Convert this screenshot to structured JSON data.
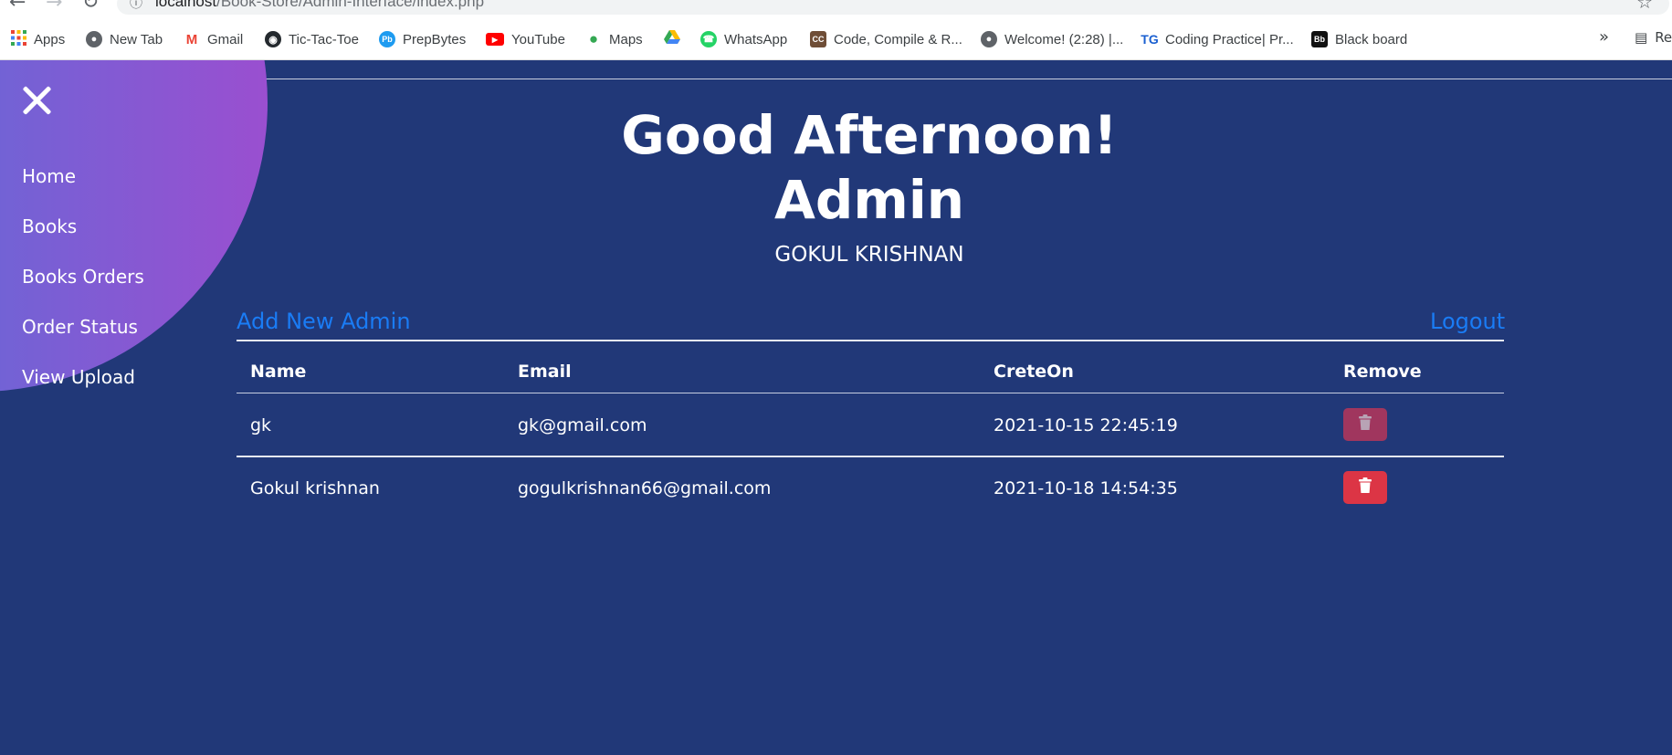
{
  "browser": {
    "url_host": "localhost",
    "url_path": "/Book-Store/Admin-Interface/index.php",
    "bookmarks": [
      {
        "label": "Apps",
        "icon": "apps-grid-icon"
      },
      {
        "label": "New Tab",
        "icon": "globe-icon"
      },
      {
        "label": "Gmail",
        "icon": "gmail-icon"
      },
      {
        "label": "Tic-Tac-Toe",
        "icon": "github-icon"
      },
      {
        "label": "PrepBytes",
        "icon": "prepbytes-icon"
      },
      {
        "label": "YouTube",
        "icon": "youtube-icon"
      },
      {
        "label": "Maps",
        "icon": "maps-pin-icon"
      },
      {
        "label": "",
        "icon": "google-drive-icon"
      },
      {
        "label": "WhatsApp",
        "icon": "whatsapp-icon"
      },
      {
        "label": "Code, Compile & R...",
        "icon": "codechef-cc-icon"
      },
      {
        "label": "Welcome! (2:28) |...",
        "icon": "globe-icon"
      },
      {
        "label": "Coding Practice| Pr...",
        "icon": "tg-icon"
      },
      {
        "label": "Black board",
        "icon": "blackboard-icon"
      }
    ],
    "overflow_label": "»",
    "reading_list_label": "Re"
  },
  "sidebar": {
    "items": [
      {
        "label": "Home"
      },
      {
        "label": "Books"
      },
      {
        "label": "Books Orders"
      },
      {
        "label": "Order Status"
      },
      {
        "label": "View Upload"
      }
    ]
  },
  "header": {
    "greeting_line1": "Good Afternoon!",
    "greeting_line2": "Admin",
    "user_name": "GOKUL KRISHNAN"
  },
  "actions": {
    "add_admin_label": "Add New Admin",
    "logout_label": "Logout"
  },
  "table": {
    "columns": [
      "Name",
      "Email",
      "CreteOn",
      "Remove"
    ],
    "rows": [
      {
        "name": "gk",
        "email": "gk@gmail.com",
        "created": "2021-10-15 22:45:19",
        "remove_enabled": false
      },
      {
        "name": "Gokul krishnan",
        "email": "gogulkrishnan66@gmail.com",
        "created": "2021-10-18 14:54:35",
        "remove_enabled": true
      }
    ]
  },
  "colors": {
    "page_bg": "#213878",
    "link": "#1a7cf5",
    "danger": "#dc3545",
    "danger_dim": "#a0365e",
    "sidebar_gradient_start": "#1fb8e2",
    "sidebar_gradient_end": "#9a4fd0"
  }
}
